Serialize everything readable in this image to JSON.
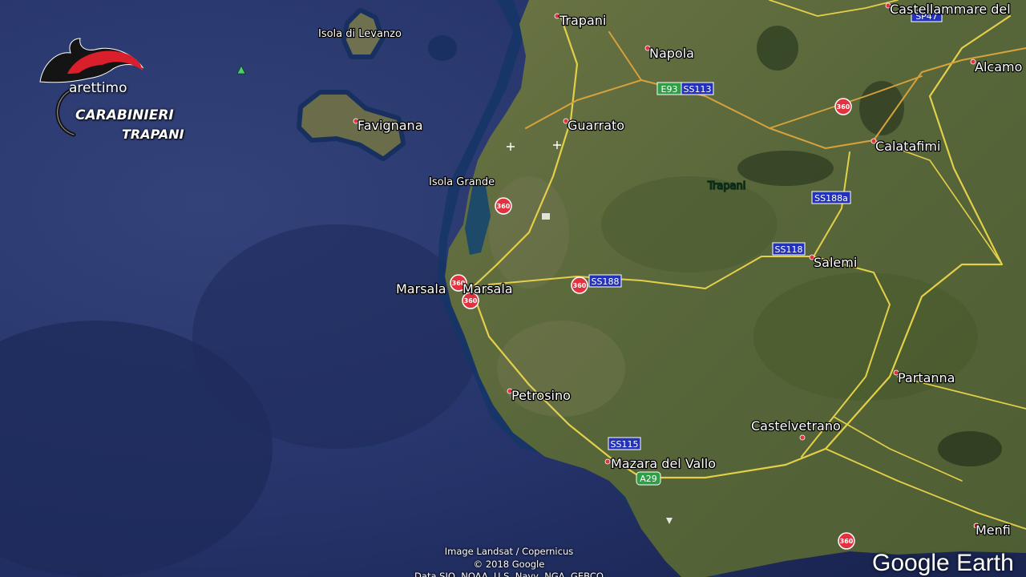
{
  "logo": {
    "town": "arettimo",
    "name": "CARABINIERI",
    "province": "TRAPANI"
  },
  "places": {
    "isola_di_levanzo": "Isola di Levanzo",
    "favignana": "Favignana",
    "isola_grande": "Isola Grande",
    "marsala_left": "Marsala",
    "marsala_right": "Marsala",
    "petrosino": "Petrosino",
    "mazara_del_vallo": "Mazara del Vallo",
    "trapani_city": "Trapani",
    "napola": "Napola",
    "guarrato": "Guarrato",
    "trapani_region": "Trapani",
    "castellammare": "Castellammare del",
    "alcamo": "Alcamo",
    "calatafimi": "Calatafimi",
    "salemi": "Salemi",
    "partanna": "Partanna",
    "castelvetrano": "Castelvetrano",
    "menfi": "Menfi"
  },
  "roads": {
    "sp47": "SP47",
    "e93": "E93",
    "ss113": "SS113",
    "ss188a": "SS188a",
    "ss118": "SS118",
    "ss188": "SS188",
    "ss115": "SS115",
    "a29": "A29"
  },
  "markers": {
    "street_view_label": "360"
  },
  "attribution": {
    "imagery": "Image Landsat / Copernicus",
    "copyright": "© 2018 Google",
    "data": "Data SIO, NOAA, U.S. Navy, NGA, GEBCO"
  },
  "brand": {
    "name": "Google Earth"
  },
  "colors": {
    "sea": "#26366a",
    "land": "#5d6a37",
    "road": "#e3cf49",
    "secondary_road": "#d7a23c",
    "marker": "#e2323f",
    "shield_blue": "#2432b8",
    "shield_green": "#2f9e47"
  }
}
